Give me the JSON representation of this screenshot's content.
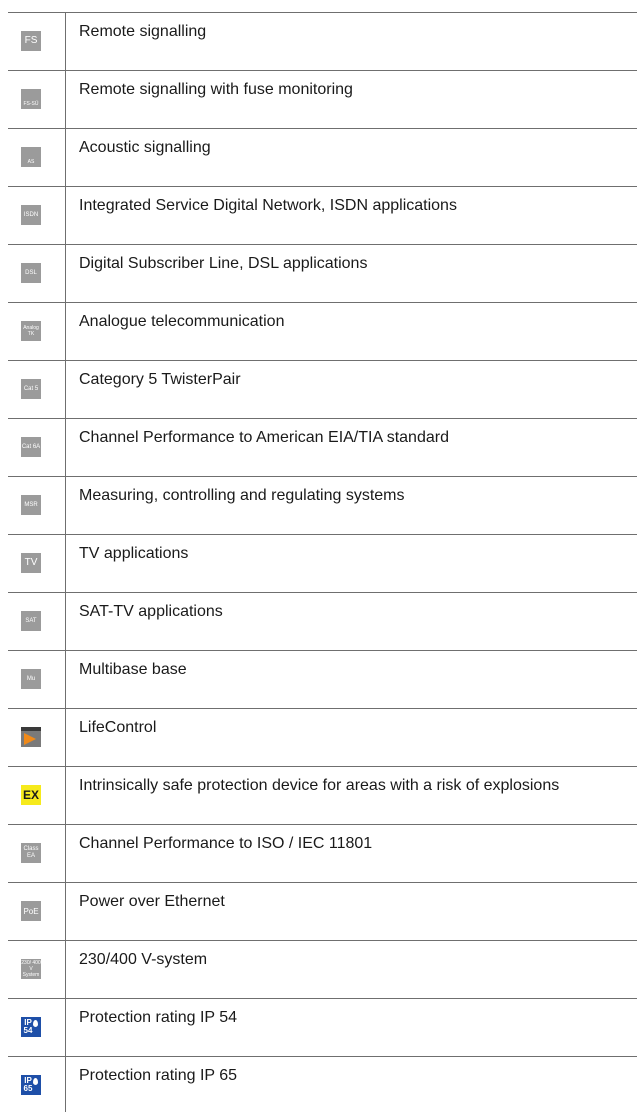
{
  "rows": [
    {
      "icon": "FS",
      "label": "Remote signalling"
    },
    {
      "icon": "FS-SÜ",
      "label": "Remote signalling with fuse monitoring"
    },
    {
      "icon": "AS",
      "label": "Acoustic signalling"
    },
    {
      "icon": "ISDN",
      "label": "Integrated Service Digital Network, ISDN applications"
    },
    {
      "icon": "DSL",
      "label": "Digital Subscriber Line, DSL applications"
    },
    {
      "icon": "Analog TK",
      "label": "Analogue telecommunication"
    },
    {
      "icon": "Cat 5",
      "label": "Category 5 TwisterPair"
    },
    {
      "icon": "Cat 6A",
      "label": "Channel Performance to American EIA/TIA standard"
    },
    {
      "icon": "MSR",
      "label": "Measuring, controlling and regulating systems"
    },
    {
      "icon": "TV",
      "label": "TV applications"
    },
    {
      "icon": "SAT",
      "label": "SAT-TV applications"
    },
    {
      "icon": "Mu",
      "label": "Multibase base"
    },
    {
      "icon": "LifeControl",
      "label": "LifeControl"
    },
    {
      "icon": "EX",
      "label": "Intrinsically safe protection device for areas with a risk of explosions"
    },
    {
      "icon": "Class EA",
      "label": "Channel Performance to ISO / IEC 11801"
    },
    {
      "icon": "PoE",
      "label": "Power over Ethernet"
    },
    {
      "icon": "230/ 400 V System",
      "label": "230/400 V-system"
    },
    {
      "icon": "IP 54",
      "label": "Protection rating IP 54"
    },
    {
      "icon": "IP 65",
      "label": "Protection rating IP 65"
    }
  ],
  "colors": {
    "grey_badge": "#9b9b9b",
    "ex_badge": "#f6ea1c",
    "ip_badge": "#1e4fa8",
    "lifecontrol_arrow": "#f08a1a"
  }
}
